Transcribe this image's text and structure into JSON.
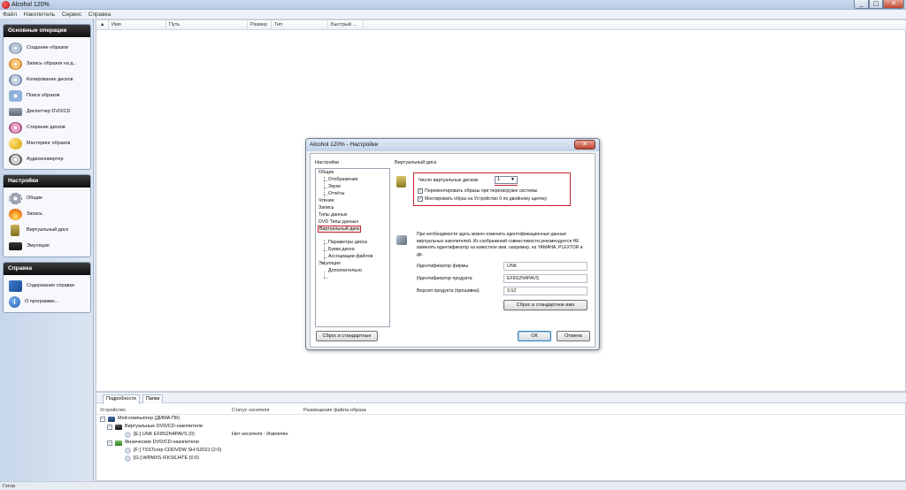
{
  "window": {
    "title": "Alcohol 120%",
    "min": "_",
    "max": "▢",
    "close": "✕"
  },
  "menu": [
    "Файл",
    "Накопитель",
    "Сервис",
    "Справка"
  ],
  "sidebar": {
    "basic": {
      "title": "Основные операции",
      "items": [
        {
          "label": "Создание образов",
          "icon": "disc-create-icon"
        },
        {
          "label": "Запись образов на д...",
          "icon": "disc-burn-icon"
        },
        {
          "label": "Копирование дисков",
          "icon": "disc-copy-icon"
        },
        {
          "label": "Поиск образов",
          "icon": "image-search-icon"
        },
        {
          "label": "Диспетчер DVD/CD",
          "icon": "drive-manager-icon"
        },
        {
          "label": "Стирание дисков",
          "icon": "disc-erase-icon"
        },
        {
          "label": "Мастеринг образов",
          "icon": "mastering-icon"
        },
        {
          "label": "Аудиоконвертер",
          "icon": "audio-converter-icon"
        }
      ]
    },
    "settings": {
      "title": "Настройки",
      "items": [
        {
          "label": "Общие",
          "icon": "gear-icon"
        },
        {
          "label": "Запись",
          "icon": "fire-icon"
        },
        {
          "label": "Виртуальный диск",
          "icon": "virtual-disk-icon"
        },
        {
          "label": "Эмуляция",
          "icon": "emulation-icon"
        }
      ]
    },
    "help": {
      "title": "Справка",
      "items": [
        {
          "label": "Содержание справки",
          "icon": "help-book-icon"
        },
        {
          "label": "О программе...",
          "icon": "info-icon"
        }
      ]
    }
  },
  "filelist": {
    "sort_indicator": "▲",
    "columns": [
      "Имя",
      "Путь",
      "Размер",
      "Тип",
      "Быстрый ..."
    ]
  },
  "bottom": {
    "tabs": [
      "Подробности",
      "Папки"
    ],
    "columns": [
      "Устройство",
      "Статус носителя",
      "Размещение файла-образа"
    ],
    "tree": [
      {
        "toggle": "−",
        "label": "Мой компьютер (ДИМА-ПК)",
        "status": ""
      },
      {
        "toggle": "−",
        "label": "Виртуальные DVD/CD-накопители",
        "status": ""
      },
      {
        "toggle": "",
        "label": "[E:] UNK EF8S2N4PAVS (0)",
        "status": "Нет носителя - Извлечён"
      },
      {
        "toggle": "−",
        "label": "Физические DVD/CD-накопители",
        "status": ""
      },
      {
        "toggle": "",
        "label": "[F:] TSSTcorp CDDVDW SH-S202J (2:0)",
        "status": ""
      },
      {
        "toggle": "",
        "label": "[G:] WRMXS IFKS6J4TE (0:0)",
        "status": ""
      }
    ]
  },
  "status": "Готов",
  "dialog": {
    "title": "Alcohol 120% - Настройки",
    "close": "✕",
    "tree_label": "Настройки",
    "tree": [
      "Общие",
      "Отображение",
      "Звуки",
      "Отчёты",
      "Чтение",
      "Запись",
      "Типы данных",
      "DVD Типы данных",
      "Виртуальный диск",
      "Параметры диска",
      "Буква диска",
      "Ассоциации файлов",
      "Эмуляция",
      "Дополнительно"
    ],
    "section": "Виртуальный диск",
    "vd_count_label": "Число виртуальных дисков:",
    "vd_count": "1",
    "check_remount": "Перемонтировать образы при перезагрузке системы",
    "check_mount": "Монтировать образ на Устройство 0 по двойному щелчку",
    "check_mark": "✓",
    "description": "При необходимости здесь можно изменить идентификационные данные виртуальных накопителей. Из соображений совместимости рекомендуется НЕ изменять идентификатор на известное имя, например, на YAMAHA, PLEXTOR и др.",
    "vendor_label": "Идентификатор фирмы",
    "vendor_value": "UNK",
    "product_label": "Идентификатор продукта",
    "product_value": "EF8S2N4PAVS",
    "revision_label": "Версия продукта (прошивка)",
    "revision_value": "3.5Z",
    "reset_ids": "Сброс в стандартное имя",
    "reset_defaults": "Сброс в стандартные",
    "ok": "ОК",
    "cancel": "Отмена"
  }
}
